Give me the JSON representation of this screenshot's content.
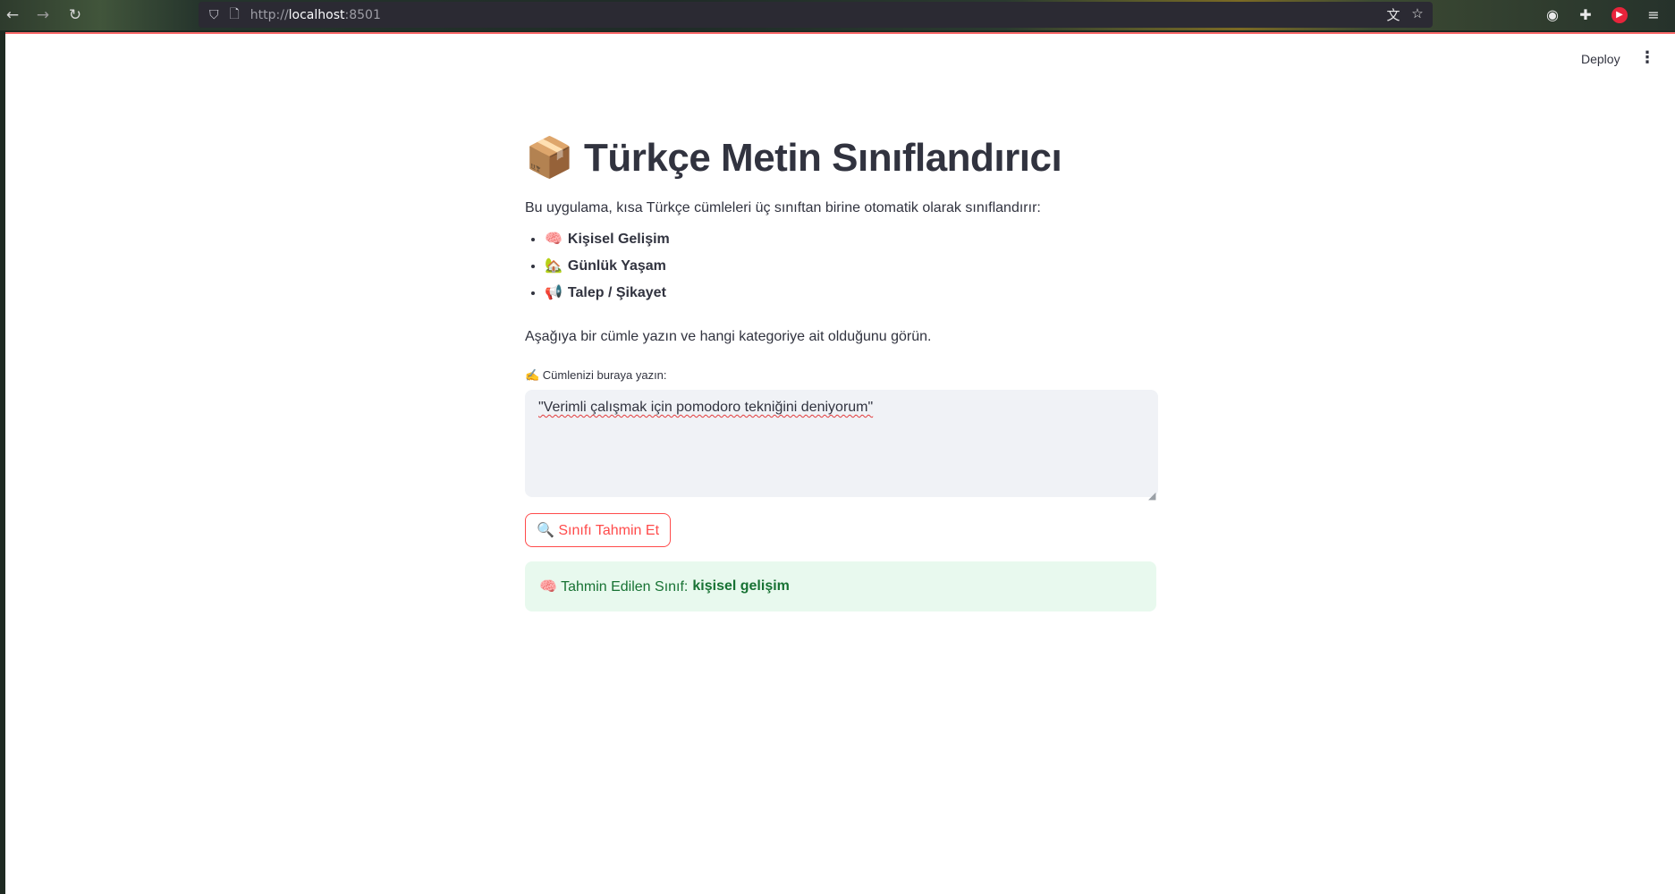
{
  "browser": {
    "url_prefix": "http://",
    "url_host": "localhost",
    "url_port": ":8501",
    "icons": [
      "back-arrow-icon",
      "forward-arrow-icon",
      "reload-icon",
      "shield-icon",
      "page-icon",
      "translate-icon",
      "star-icon",
      "account-icon",
      "extensions-icon",
      "youtube-icon",
      "menu-icon"
    ]
  },
  "header": {
    "deploy_label": "Deploy",
    "menu_glyph": "⋮"
  },
  "main": {
    "title_emoji": "📦",
    "title": "Türkçe Metin Sınıflandırıcı",
    "intro": "Bu uygulama, kısa Türkçe cümleleri üç sınıftan birine otomatik olarak sınıflandırır:",
    "categories": [
      {
        "emoji": "🧠",
        "label": "Kişisel Gelişim"
      },
      {
        "emoji": "🏡",
        "label": "Günlük Yaşam"
      },
      {
        "emoji": "📢",
        "label": "Talep / Şikayet"
      }
    ],
    "instruction": "Aşağıya bir cümle yazın ve hangi kategoriye ait olduğunu görün.",
    "input_label": "✍️ Cümlenizi buraya yazın:",
    "input_value": "\"Verimli çalışmak için pomodoro tekniğini deniyorum\"",
    "button_label": "🔍 Sınıfı Tahmin Et",
    "result_prefix": "🧠 Tahmin Edilen Sınıf:",
    "result_value": "kişisel gelişim"
  },
  "colors": {
    "accent": "#ff4b4b",
    "success_bg": "#e8f9ee",
    "success_text": "#177233",
    "text": "#31333f"
  }
}
